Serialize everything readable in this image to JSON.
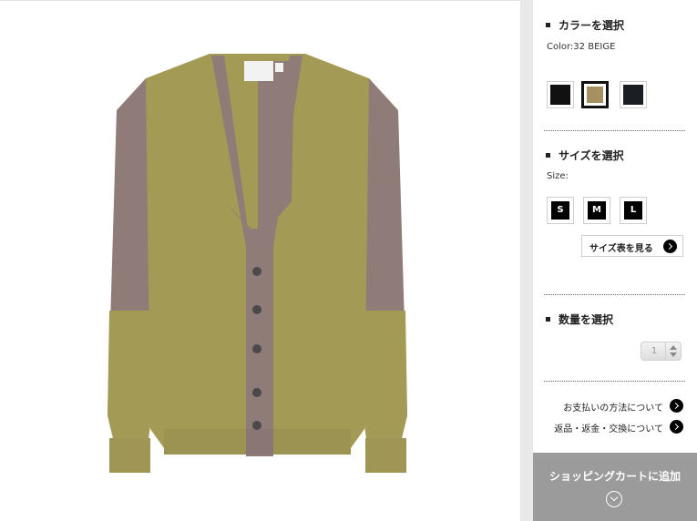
{
  "colors": {
    "sweater_body": "#a39a55",
    "sweater_contrast": "#8f7b78",
    "swatch_black": "#111111",
    "swatch_beige": "#a59060",
    "swatch_navy": "#1b1f24",
    "cart_button": "#9b9b9b",
    "divider": "#e9e9e9"
  },
  "product_image": {
    "description_icon": "cardigan-image"
  },
  "color_section": {
    "title": "カラーを選択",
    "current_label": "Color:32 BEIGE",
    "swatches": [
      {
        "name": "black",
        "selected": false
      },
      {
        "name": "beige",
        "selected": true
      },
      {
        "name": "navy",
        "selected": false
      }
    ]
  },
  "size_section": {
    "title": "サイズを選択",
    "current_label": "Size:",
    "sizes": [
      "S",
      "M",
      "L"
    ],
    "size_chart_label": "サイズ表を見る"
  },
  "quantity_section": {
    "title": "数量を選択",
    "value": "1"
  },
  "links": {
    "payment": "お支払いの方法について",
    "returns": "返品・返金・交換について"
  },
  "cart": {
    "label": "ショッピングカートに追加"
  }
}
